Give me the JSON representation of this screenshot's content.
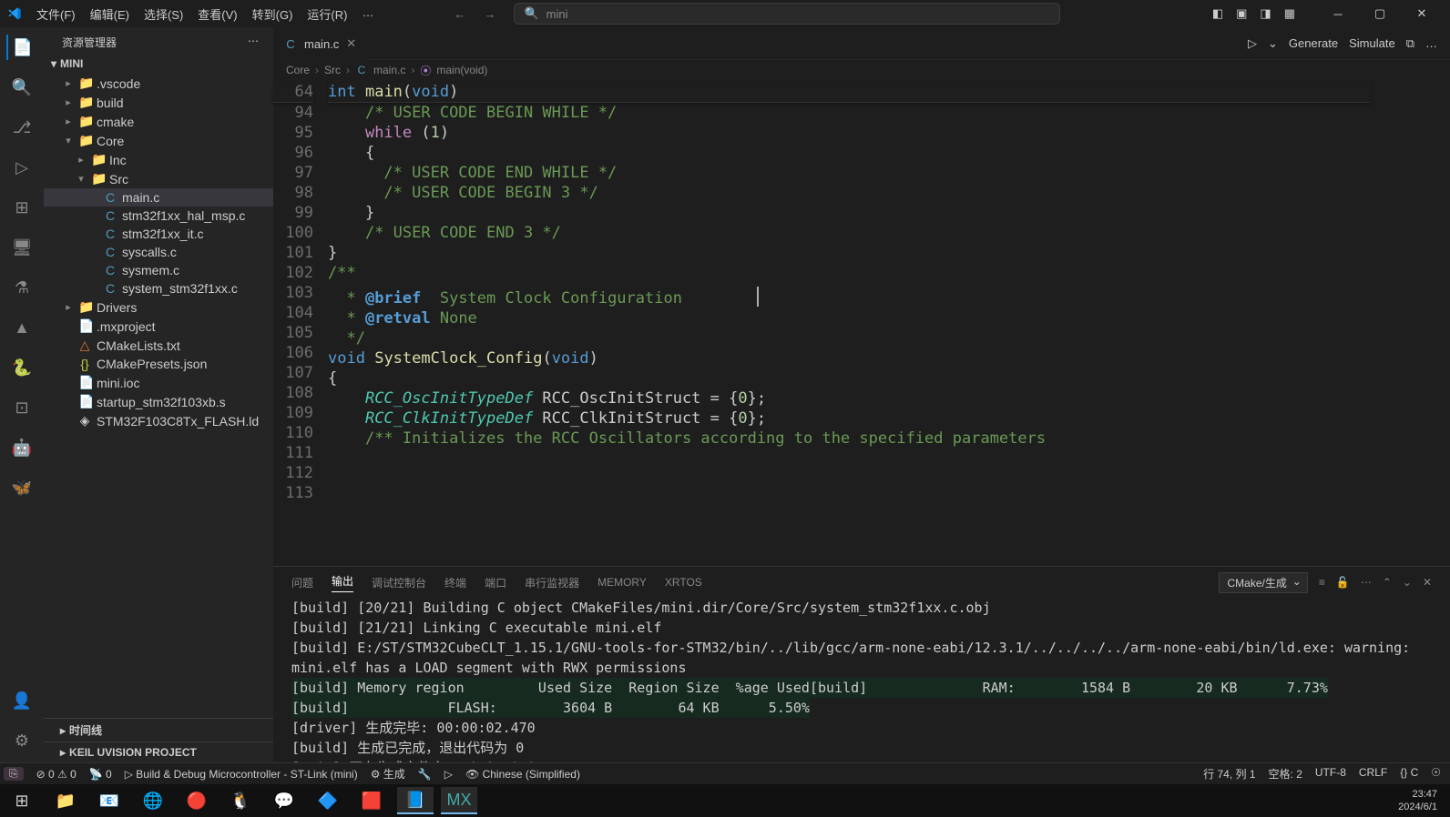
{
  "menus": [
    "文件(F)",
    "编辑(E)",
    "选择(S)",
    "查看(V)",
    "转到(G)",
    "运行(R)",
    "…"
  ],
  "search_placeholder": "mini",
  "explorer_title": "资源管理器",
  "project_root": "MINI",
  "tree": [
    {
      "indent": 1,
      "chev": "▸",
      "icon": "📁",
      "name": ".vscode"
    },
    {
      "indent": 1,
      "chev": "▸",
      "icon": "📁",
      "name": "build"
    },
    {
      "indent": 1,
      "chev": "▸",
      "icon": "📁",
      "name": "cmake"
    },
    {
      "indent": 1,
      "chev": "▾",
      "icon": "📁",
      "name": "Core"
    },
    {
      "indent": 2,
      "chev": "▸",
      "icon": "📁",
      "name": "Inc"
    },
    {
      "indent": 2,
      "chev": "▾",
      "icon": "📁",
      "name": "Src"
    },
    {
      "indent": 3,
      "chev": " ",
      "icon": "C",
      "iconColor": "#519aba",
      "name": "main.c",
      "selected": true
    },
    {
      "indent": 3,
      "chev": " ",
      "icon": "C",
      "iconColor": "#519aba",
      "name": "stm32f1xx_hal_msp.c"
    },
    {
      "indent": 3,
      "chev": " ",
      "icon": "C",
      "iconColor": "#519aba",
      "name": "stm32f1xx_it.c"
    },
    {
      "indent": 3,
      "chev": " ",
      "icon": "C",
      "iconColor": "#519aba",
      "name": "syscalls.c"
    },
    {
      "indent": 3,
      "chev": " ",
      "icon": "C",
      "iconColor": "#519aba",
      "name": "sysmem.c"
    },
    {
      "indent": 3,
      "chev": " ",
      "icon": "C",
      "iconColor": "#519aba",
      "name": "system_stm32f1xx.c"
    },
    {
      "indent": 1,
      "chev": "▸",
      "icon": "📁",
      "name": "Drivers"
    },
    {
      "indent": 1,
      "chev": " ",
      "icon": "📄",
      "name": ".mxproject"
    },
    {
      "indent": 1,
      "chev": " ",
      "icon": "△",
      "iconColor": "#e37933",
      "name": "CMakeLists.txt"
    },
    {
      "indent": 1,
      "chev": " ",
      "icon": "{}",
      "iconColor": "#cbcb41",
      "name": "CMakePresets.json"
    },
    {
      "indent": 1,
      "chev": " ",
      "icon": "📄",
      "name": "mini.ioc"
    },
    {
      "indent": 1,
      "chev": " ",
      "icon": "📄",
      "name": "startup_stm32f103xb.s"
    },
    {
      "indent": 1,
      "chev": " ",
      "icon": "◈",
      "iconColor": "#ccc",
      "name": "STM32F103C8Tx_FLASH.ld"
    }
  ],
  "sidebar_sections": [
    "时间线",
    "KEIL UVISION PROJECT"
  ],
  "tab": {
    "label": "main.c",
    "icon": "C"
  },
  "editor_actions": [
    "▷",
    "⌄",
    "Generate",
    "Simulate",
    "⧉",
    "…"
  ],
  "breadcrumb": [
    "Core",
    "Src",
    "main.c",
    "main(void)"
  ],
  "sticky_line": {
    "num": "64",
    "html": "<span class='kw'>int</span> <span class='fn'>main</span>(<span class='kw'>void</span>)"
  },
  "code_lines": [
    {
      "num": "94",
      "html": "    <span class='cm'>/* USER CODE BEGIN WHILE */</span>"
    },
    {
      "num": "95",
      "html": "    <span class='wd'>while</span> (<span class='nm'>1</span>)"
    },
    {
      "num": "96",
      "html": "    {"
    },
    {
      "num": "97",
      "html": "      <span class='cm'>/* USER CODE END WHILE */</span>"
    },
    {
      "num": "98",
      "html": ""
    },
    {
      "num": "99",
      "html": "      <span class='cm'>/* USER CODE BEGIN 3 */</span>"
    },
    {
      "num": "100",
      "html": "    }"
    },
    {
      "num": "101",
      "html": "    <span class='cm'>/* USER CODE END 3 */</span>"
    },
    {
      "num": "102",
      "html": "}"
    },
    {
      "num": "103",
      "html": ""
    },
    {
      "num": "104",
      "html": "<span class='cm'>/**</span>"
    },
    {
      "num": "105",
      "html": "<span class='cm'>  * <span class='dc'>@brief</span>  System Clock Configuration</span>"
    },
    {
      "num": "106",
      "html": "<span class='cm'>  * <span class='dc'>@retval</span> None</span>"
    },
    {
      "num": "107",
      "html": "<span class='cm'>  */</span>"
    },
    {
      "num": "108",
      "html": "<span class='kw'>void</span> <span class='fn'>SystemClock_Config</span>(<span class='kw'>void</span>)"
    },
    {
      "num": "109",
      "html": "{"
    },
    {
      "num": "110",
      "html": "    <span class='ty'><i>RCC_OscInitTypeDef</i></span> RCC_OscInitStruct = {<span class='nm'>0</span>};"
    },
    {
      "num": "111",
      "html": "    <span class='ty'><i>RCC_ClkInitTypeDef</i></span> RCC_ClkInitStruct = {<span class='nm'>0</span>};"
    },
    {
      "num": "112",
      "html": ""
    },
    {
      "num": "113",
      "html": "    <span class='cm'>/** Initializes the RCC Oscillators according to the specified parameters</span>"
    }
  ],
  "panel_tabs": [
    "问题",
    "输出",
    "调试控制台",
    "终端",
    "端口",
    "串行监视器",
    "MEMORY",
    "XRTOS"
  ],
  "panel_active_tab": 1,
  "panel_selector": "CMake/生成",
  "output_lines": [
    "[build] [20/21] Building C object CMakeFiles/mini.dir/Core/Src/system_stm32f1xx.c.obj",
    "[build] [21/21] Linking C executable mini.elf",
    "[build] E:/ST/STM32CubeCLT_1.15.1/GNU-tools-for-STM32/bin/../lib/gcc/arm-none-eabi/12.3.1/../../../../arm-none-eabi/bin/ld.exe: warning: mini.elf has a LOAD segment with RWX permissions",
    "[build] Memory region         Used Size  Region Size  %age Used",
    "[build]              RAM:        1584 B        20 KB      7.73%",
    "[build]            FLASH:        3604 B        64 KB      5.50%",
    "[driver] 生成完毕: 00:00:02.470",
    "[build] 生成已完成，退出代码为 0",
    "[main] 正在生成文件夹: mini mini"
  ],
  "status_left": {
    "remote": "⎘",
    "err_warn": "⊘ 0  ⚠ 0",
    "ports": "📡 0",
    "debug": "▷ Build & Debug Microcontroller - ST-Link (mini)",
    "gen": "⚙ 生成",
    "wrench": "🔧",
    "play": "▷",
    "lang": "👁 Chinese (Simplified)"
  },
  "status_right": [
    "行 74, 列 1",
    "空格: 2",
    "UTF-8",
    "CRLF",
    "{} C",
    "☉"
  ],
  "clock": {
    "time": "23:47",
    "date": "2024/6/1"
  }
}
